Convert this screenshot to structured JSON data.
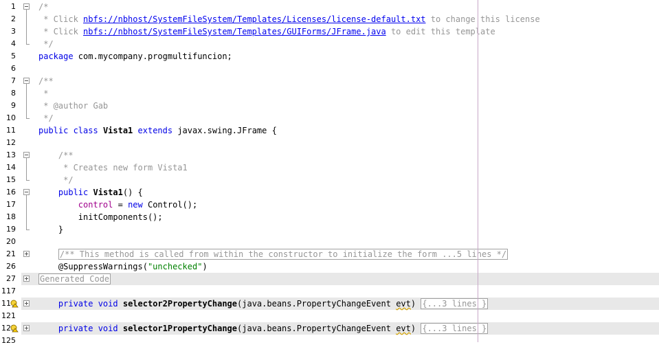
{
  "editor": {
    "lines": [
      {
        "num": "1",
        "parts": [
          {
            "t": "/*",
            "c": "cm"
          }
        ]
      },
      {
        "num": "2",
        "parts": [
          {
            "t": " * Click ",
            "c": "cm"
          },
          {
            "t": "nbfs://nbhost/SystemFileSystem/Templates/Licenses/license-default.txt",
            "c": "lnk"
          },
          {
            "t": " to change this license",
            "c": "cm"
          }
        ]
      },
      {
        "num": "3",
        "parts": [
          {
            "t": " * Click ",
            "c": "cm"
          },
          {
            "t": "nbfs://nbhost/SystemFileSystem/Templates/GUIForms/JFrame.java",
            "c": "lnk"
          },
          {
            "t": " to edit this template",
            "c": "cm"
          }
        ]
      },
      {
        "num": "4",
        "parts": [
          {
            "t": " */",
            "c": "cm"
          }
        ]
      },
      {
        "num": "5",
        "parts": [
          {
            "t": "package",
            "c": "kw"
          },
          {
            "t": " com.mycompany.progmultifuncion;",
            "c": ""
          }
        ]
      },
      {
        "num": "6",
        "parts": []
      },
      {
        "num": "7",
        "parts": [
          {
            "t": "/**",
            "c": "cm"
          }
        ]
      },
      {
        "num": "8",
        "parts": [
          {
            "t": " *",
            "c": "cm"
          }
        ]
      },
      {
        "num": "9",
        "parts": [
          {
            "t": " * @author Gab",
            "c": "cm"
          }
        ]
      },
      {
        "num": "10",
        "parts": [
          {
            "t": " */",
            "c": "cm"
          }
        ]
      },
      {
        "num": "11",
        "parts": [
          {
            "t": "public class",
            "c": "kw"
          },
          {
            "t": " ",
            "c": ""
          },
          {
            "t": "Vista1",
            "c": "b"
          },
          {
            "t": " ",
            "c": ""
          },
          {
            "t": "extends",
            "c": "kw"
          },
          {
            "t": " javax.swing.JFrame {",
            "c": ""
          }
        ]
      },
      {
        "num": "12",
        "parts": []
      },
      {
        "num": "13",
        "parts": [
          {
            "t": "    /**",
            "c": "cm"
          }
        ]
      },
      {
        "num": "14",
        "parts": [
          {
            "t": "     * Creates new form Vista1",
            "c": "cm"
          }
        ]
      },
      {
        "num": "15",
        "parts": [
          {
            "t": "     */",
            "c": "cm"
          }
        ]
      },
      {
        "num": "16",
        "parts": [
          {
            "t": "    ",
            "c": ""
          },
          {
            "t": "public",
            "c": "kw"
          },
          {
            "t": " ",
            "c": ""
          },
          {
            "t": "Vista1",
            "c": "b"
          },
          {
            "t": "() {",
            "c": ""
          }
        ]
      },
      {
        "num": "17",
        "parts": [
          {
            "t": "        ",
            "c": ""
          },
          {
            "t": "control",
            "c": "fld"
          },
          {
            "t": " = ",
            "c": ""
          },
          {
            "t": "new",
            "c": "kw"
          },
          {
            "t": " Control();",
            "c": ""
          }
        ]
      },
      {
        "num": "18",
        "parts": [
          {
            "t": "        initComponents();",
            "c": ""
          }
        ]
      },
      {
        "num": "19",
        "parts": [
          {
            "t": "    }",
            "c": ""
          }
        ]
      },
      {
        "num": "20",
        "parts": []
      },
      {
        "num": "21",
        "parts": [
          {
            "t": "    ",
            "c": ""
          },
          {
            "t": "/** This method is called from within the constructor to initialize the form ...5 lines */",
            "c": "box"
          }
        ]
      },
      {
        "num": "26",
        "parts": [
          {
            "t": "    @SuppressWarnings(",
            "c": ""
          },
          {
            "t": "\"unchecked\"",
            "c": "strg"
          },
          {
            "t": ")",
            "c": ""
          }
        ]
      },
      {
        "num": "27",
        "parts": [
          {
            "t": "Generated Code",
            "c": "box"
          }
        ]
      },
      {
        "num": "117",
        "parts": []
      },
      {
        "num": "118",
        "parts": [
          {
            "t": "    ",
            "c": ""
          },
          {
            "t": "private void",
            "c": "kw"
          },
          {
            "t": " ",
            "c": ""
          },
          {
            "t": "selector2PropertyChange",
            "c": "b"
          },
          {
            "t": "(java.beans.PropertyChangeEvent ",
            "c": ""
          },
          {
            "t": "evt",
            "c": "squig"
          },
          {
            "t": ") ",
            "c": ""
          },
          {
            "t": "{...3 lines }",
            "c": "box"
          }
        ]
      },
      {
        "num": "121",
        "parts": []
      },
      {
        "num": "122",
        "parts": [
          {
            "t": "    ",
            "c": ""
          },
          {
            "t": "private void",
            "c": "kw"
          },
          {
            "t": " ",
            "c": ""
          },
          {
            "t": "selector1PropertyChange",
            "c": "b"
          },
          {
            "t": "(java.beans.PropertyChangeEvent ",
            "c": ""
          },
          {
            "t": "evt",
            "c": "squig"
          },
          {
            "t": ") ",
            "c": ""
          },
          {
            "t": "{...3 lines }",
            "c": "box"
          }
        ]
      },
      {
        "num": "125",
        "parts": []
      }
    ],
    "highlighted_lines": [
      "27",
      "118",
      "122"
    ],
    "hint_icon_lines": [
      "118",
      "122"
    ],
    "fold_minus_lines": [
      "1",
      "7",
      "13",
      "16"
    ],
    "fold_plus_lines": [
      "21",
      "27",
      "118",
      "122"
    ],
    "colors": {
      "keyword": "#0000e6",
      "comment": "#969696",
      "link": "#0000ee",
      "field": "#a0008c",
      "string": "#008000",
      "highlight": "#e8e8e8"
    }
  }
}
